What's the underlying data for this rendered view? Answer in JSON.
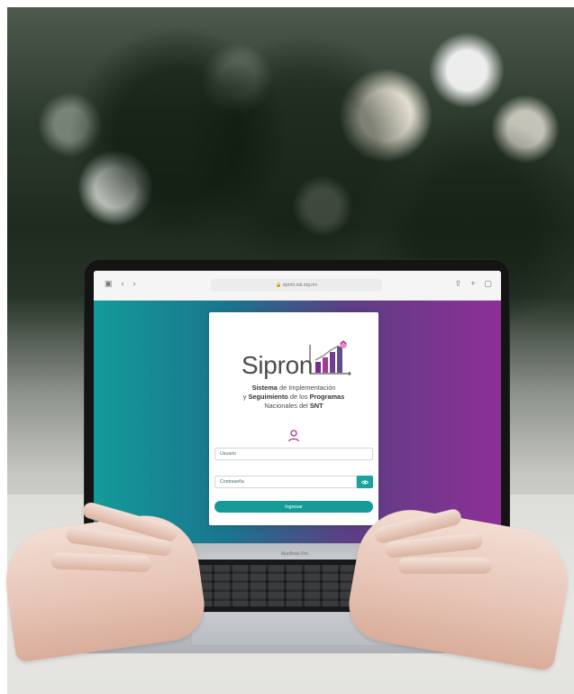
{
  "browser": {
    "address": "sipron.nal.org.mx",
    "left_icons": [
      "sidebar-toggle-icon",
      "chevron-left-icon",
      "chevron-right-icon"
    ],
    "right_icons": [
      "share-icon",
      "plus-icon",
      "tabs-icon"
    ]
  },
  "login": {
    "logo_word": "Sipron",
    "subtitle_line1_bold": "Sistema",
    "subtitle_line1_rest": " de Implementación",
    "subtitle_line2_prefix": "y ",
    "subtitle_line2_bold": "Seguimiento",
    "subtitle_line2_mid": " de los ",
    "subtitle_line2_bold2": "Programas",
    "subtitle_line3_prefix": "Nacionales del ",
    "subtitle_line3_bold": "SNT",
    "username_placeholder": "Usuario",
    "password_placeholder": "Contraseña",
    "submit_label": "Ingresar"
  },
  "laptop": {
    "brand_label": "MacBook Pro"
  },
  "colors": {
    "teal": "#159b97",
    "purple": "#8d2f97",
    "logo_purple": "#7b2b8e"
  }
}
